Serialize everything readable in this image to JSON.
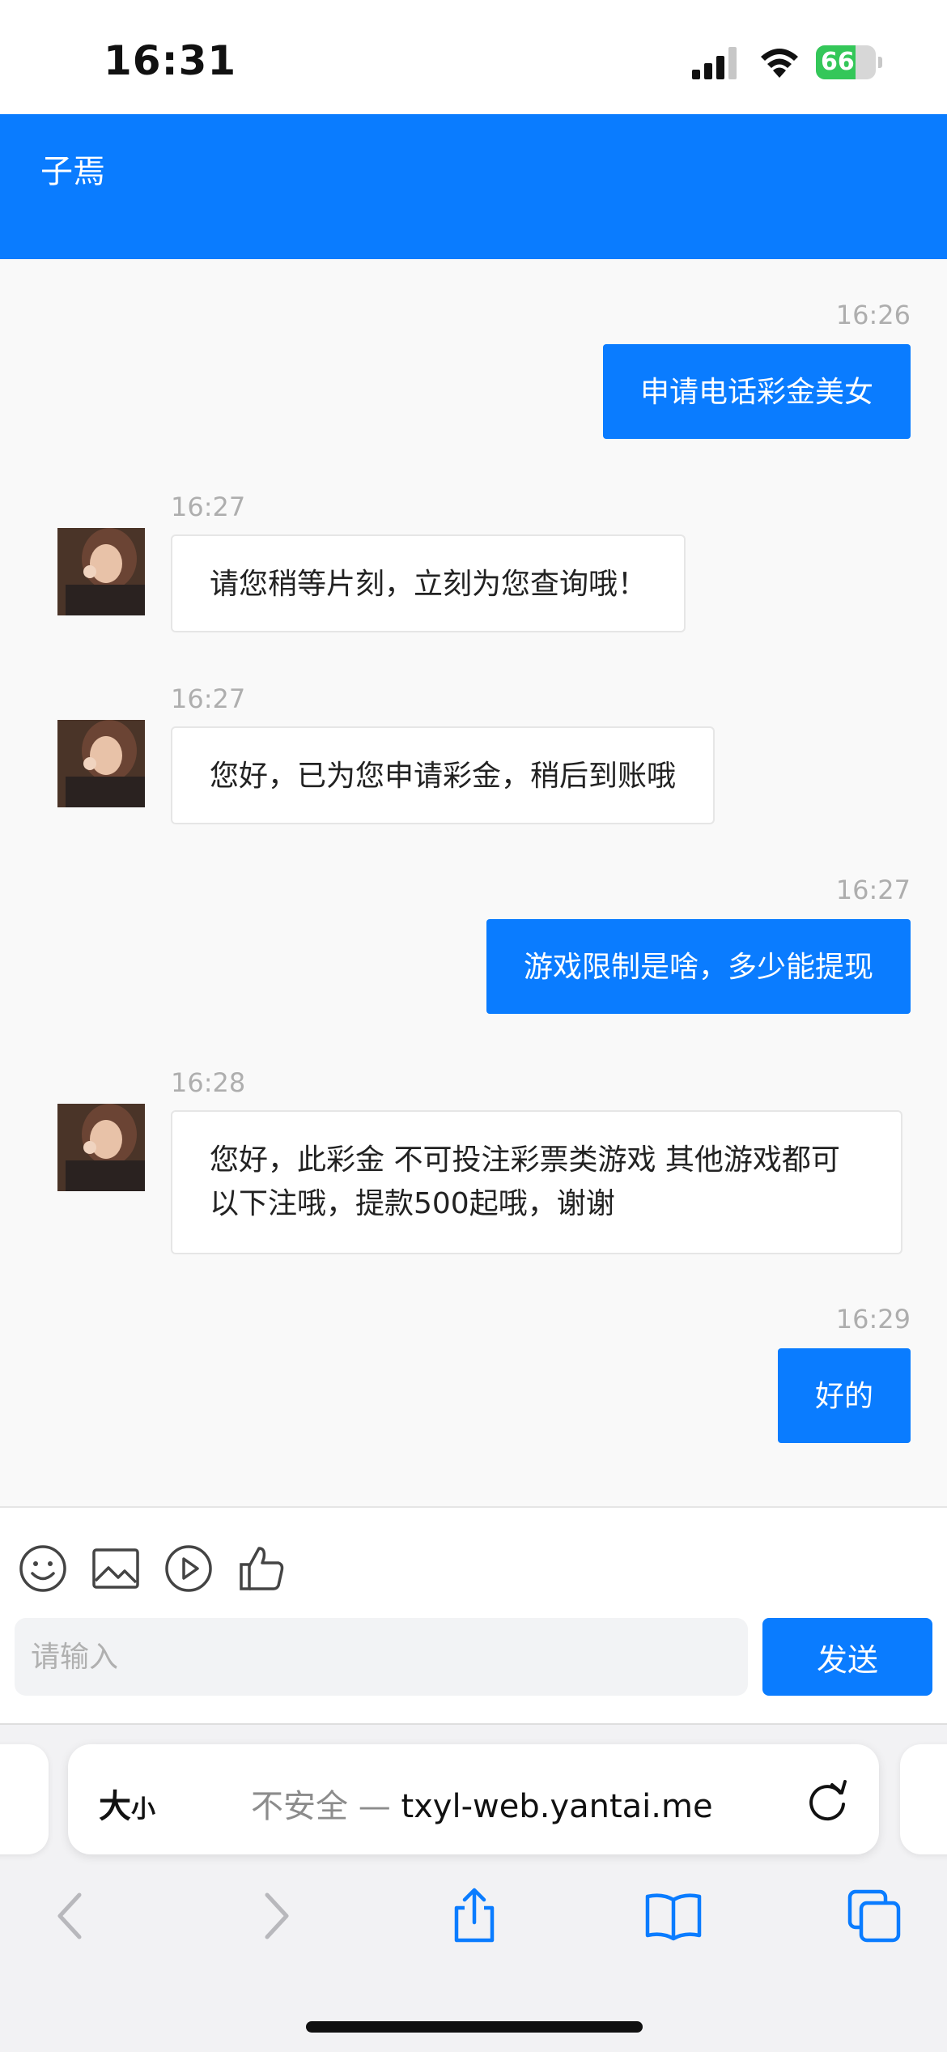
{
  "status_bar": {
    "time": "16:31",
    "battery_level": "66",
    "battery_fraction": 0.66
  },
  "header": {
    "title": "子焉"
  },
  "messages": [
    {
      "direction": "out",
      "time": "16:26",
      "text": "申请电话彩金美女"
    },
    {
      "direction": "in",
      "time": "16:27",
      "text": "请您稍等片刻，立刻为您查询哦！"
    },
    {
      "direction": "in",
      "time": "16:27",
      "text": "您好，已为您申请彩金，稍后到账哦"
    },
    {
      "direction": "out",
      "time": "16:27",
      "text": "游戏限制是啥，多少能提现"
    },
    {
      "direction": "in",
      "time": "16:28",
      "text": "您好，此彩金 不可投注彩票类游戏 其他游戏都可以下注哦，提款500起哦，谢谢"
    },
    {
      "direction": "out",
      "time": "16:29",
      "text": "好的"
    }
  ],
  "composer": {
    "tools": [
      "emoji-icon",
      "image-icon",
      "video-icon",
      "thumbs-up-icon"
    ],
    "placeholder": "请输入",
    "value": "",
    "send_label": "发送"
  },
  "browser": {
    "text_size_big": "大",
    "text_size_small": "小",
    "security_label": "不安全 —",
    "url": "txyl-web.yantai.me",
    "nav_icons": [
      "back-icon",
      "forward-icon",
      "share-icon",
      "bookmarks-icon",
      "tabs-icon"
    ]
  },
  "colors": {
    "accent": "#0a7cff",
    "battery": "#34c759"
  }
}
